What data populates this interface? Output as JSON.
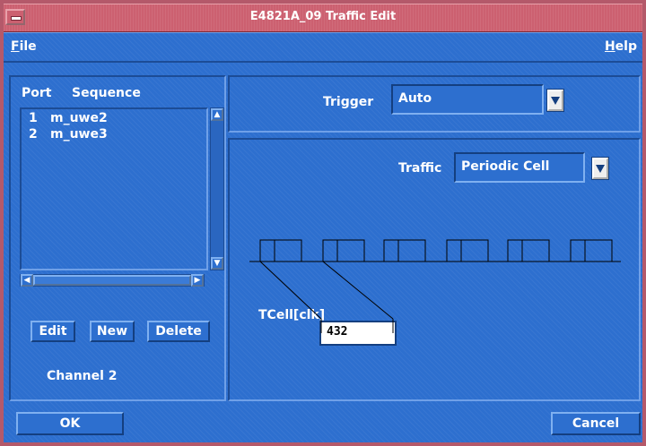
{
  "window": {
    "title": "E4821A_09 Traffic Edit"
  },
  "menubar": {
    "file": {
      "mnemonic": "F",
      "rest": "ile"
    },
    "help": {
      "mnemonic": "H",
      "rest": "elp"
    }
  },
  "list": {
    "header_port": "Port",
    "header_sequence": "Sequence",
    "rows": [
      {
        "port": "1",
        "sequence": "m_uwe2"
      },
      {
        "port": "2",
        "sequence": "m_uwe3"
      }
    ]
  },
  "buttons": {
    "edit": "Edit",
    "new": "New",
    "delete": "Delete",
    "ok": "OK",
    "cancel": "Cancel"
  },
  "channel_label": "Channel 2",
  "trigger": {
    "label": "Trigger",
    "value": "Auto"
  },
  "traffic": {
    "label": "Traffic",
    "value": "Periodic Cell"
  },
  "tcell": {
    "label": "TCell[clk]",
    "value": "432"
  },
  "icons": {
    "system_menu": "system-menu-icon",
    "dropdown": "triangle-down-icon",
    "scroll_up": "triangle-up-icon",
    "scroll_down": "triangle-down-icon",
    "scroll_left": "triangle-left-icon",
    "scroll_right": "triangle-right-icon"
  },
  "colors": {
    "frame": "#b4596a",
    "panel": "#2d6fcf",
    "text": "#ffffff"
  }
}
